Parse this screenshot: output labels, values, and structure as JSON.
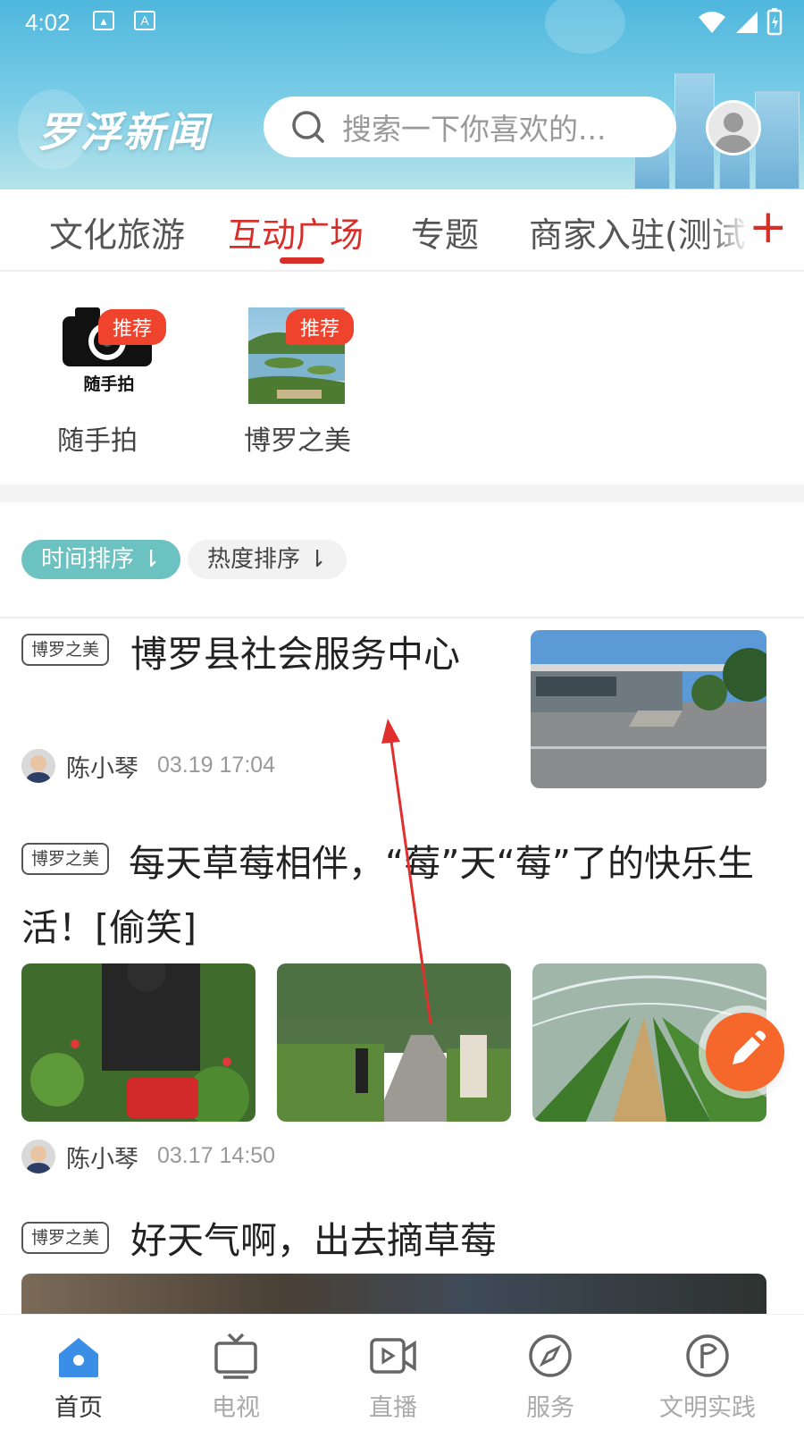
{
  "status_bar": {
    "time": "4:02",
    "icons": [
      "image-icon",
      "a-icon"
    ],
    "right_icons": [
      "wifi-icon",
      "signal-icon",
      "battery-icon"
    ]
  },
  "header": {
    "brand": "罗浮新闻",
    "search": {
      "placeholder": "搜索一下你喜欢的..."
    }
  },
  "tabs": [
    {
      "label": "文化旅游",
      "active": false
    },
    {
      "label": "互动广场",
      "active": true
    },
    {
      "label": "专题",
      "active": false
    },
    {
      "label": "商家入驻(测试",
      "active": false
    }
  ],
  "tab_add": "+",
  "quick_entries": [
    {
      "label": "随手拍",
      "badge": "推荐",
      "icon_text": "随手拍"
    },
    {
      "label": "博罗之美",
      "badge": "推荐"
    }
  ],
  "sort": {
    "time": "时间排序",
    "hot": "热度排序"
  },
  "posts": [
    {
      "tag": "博罗之美",
      "title": "博罗县社会服务中心",
      "author": "陈小琴",
      "time": "03.19 17:04"
    },
    {
      "tag": "博罗之美",
      "title": "每天草莓相伴，“莓”天“莓”了的快乐生活！[偷笑]",
      "author": "陈小琴",
      "time": "03.17 14:50"
    },
    {
      "tag": "博罗之美",
      "title": "好天气啊，出去摘草莓"
    }
  ],
  "bottom_nav": [
    {
      "label": "首页",
      "icon": "home-icon",
      "active": true
    },
    {
      "label": "电视",
      "icon": "tv-icon",
      "active": false
    },
    {
      "label": "直播",
      "icon": "live-icon",
      "active": false
    },
    {
      "label": "服务",
      "icon": "compass-icon",
      "active": false
    },
    {
      "label": "文明实践",
      "icon": "flag-circle-icon",
      "active": false
    }
  ],
  "colors": {
    "accent_red": "#d62f2a",
    "header_blue": "#4fb7dd",
    "sort_teal": "#6cc2c0",
    "nav_blue": "#3a8ee6",
    "fab_orange": "#f5672b"
  }
}
